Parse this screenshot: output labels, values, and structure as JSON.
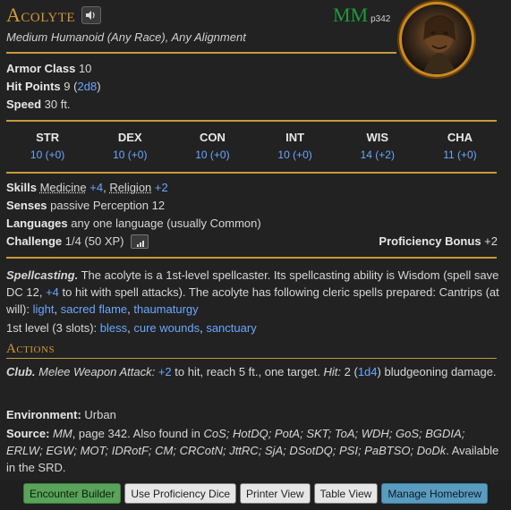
{
  "monster": {
    "name": "Acolyte",
    "source_abbr": "MM",
    "source_page": "p342",
    "subtitle": "Medium Humanoid (Any Race), Any Alignment",
    "armor_class_label": "Armor Class",
    "armor_class_value": "10",
    "hp_label": "Hit Points",
    "hp_value": "9",
    "hp_open": "(",
    "hp_dice": "2d8",
    "hp_close": ")",
    "speed_label": "Speed",
    "speed_value": "30 ft."
  },
  "abilities": [
    {
      "name": "STR",
      "value": "10 (+0)"
    },
    {
      "name": "DEX",
      "value": "10 (+0)"
    },
    {
      "name": "CON",
      "value": "10 (+0)"
    },
    {
      "name": "INT",
      "value": "10 (+0)"
    },
    {
      "name": "WIS",
      "value": "14 (+2)"
    },
    {
      "name": "CHA",
      "value": "11 (+0)"
    }
  ],
  "details": {
    "skills_label": "Skills",
    "skill_1_name": "Medicine",
    "skill_1_bonus": "+4",
    "skill_2_name": "Religion",
    "skill_2_bonus": "+2",
    "senses_label": "Senses",
    "senses_value": "passive Perception 12",
    "languages_label": "Languages",
    "languages_value": "any one language (usually Common)",
    "challenge_label": "Challenge",
    "challenge_value": "1/4 (50 XP)",
    "prof_label": "Proficiency Bonus",
    "prof_value": "+2"
  },
  "traits": {
    "spellcasting_name": "Spellcasting.",
    "spellcasting_text_1": "The acolyte is a 1st-level spellcaster. Its spellcasting ability is Wisdom (spell save DC 12,",
    "spellcasting_bonus": "+4",
    "spellcasting_text_2": "to hit with spell attacks). The acolyte has following cleric spells prepared:",
    "cantrips_label": "Cantrips (at will):",
    "cantrips": [
      "light",
      "sacred flame",
      "thaumaturgy"
    ],
    "level1_label": "1st level (3 slots):",
    "level1_spells": [
      "bless",
      "cure wounds",
      "sanctuary"
    ]
  },
  "actions": {
    "heading": "Actions",
    "club_name": "Club.",
    "club_type": "Melee Weapon Attack:",
    "club_bonus": "+2",
    "club_text_1": "to hit, reach 5 ft., one target.",
    "club_hit_label": "Hit:",
    "club_dmg": "2",
    "club_dice": "1d4",
    "club_text_2": "bludgeoning damage."
  },
  "environment": {
    "label": "Environment:",
    "value": "Urban"
  },
  "source": {
    "label": "Source:",
    "book": "MM",
    "text_1": ", page 342. Also found in",
    "list_line1": "CoS; HotDQ; PotA; SKT; ToA; WDH; GoS; BGDIA; ERLW;",
    "list_line2": "EGW; MOT; IDRotF; CM; CRCotN; JttRC; SjA; DSotDQ; PSI; PaBTSO; DoDk",
    "text_2": ". Available in the SRD."
  },
  "footer": {
    "buttons": [
      "Encounter Builder",
      "Use Proficiency Dice",
      "Printer View",
      "Table View",
      "Manage Homebrew"
    ]
  },
  "colors": {
    "accent_gold": "#d29a38",
    "source_green": "#1f9a3a",
    "link_blue": "#6aa7ff"
  }
}
